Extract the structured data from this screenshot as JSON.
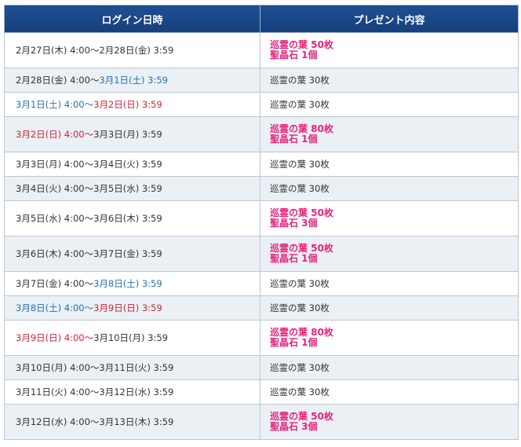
{
  "colors": {
    "header_bg": "#1d4b8e",
    "row_alt": "#eaf0f4",
    "saturday": "#2472b8",
    "sunday": "#d3233a",
    "highlight": "#e5257c"
  },
  "headers": {
    "date": "ログイン日時",
    "present": "プレゼント内容"
  },
  "rows": [
    {
      "alt": false,
      "big": true,
      "date": [
        {
          "t": "2月27日(木) 4:00～2月28日(金) 3:59",
          "c": ""
        }
      ],
      "present": [
        "巡霊の葉 50枚",
        "聖晶石 1個"
      ],
      "hl": true
    },
    {
      "alt": true,
      "big": false,
      "date": [
        {
          "t": "2月28日(金) 4:00～",
          "c": ""
        },
        {
          "t": "3月1日(土) 3:59",
          "c": "sat"
        }
      ],
      "present": [
        "巡霊の葉 30枚"
      ],
      "hl": false
    },
    {
      "alt": false,
      "big": false,
      "date": [
        {
          "t": "3月1日(土) 4:00～",
          "c": "sat"
        },
        {
          "t": "3月2日(日) 3:59",
          "c": "sun"
        }
      ],
      "present": [
        "巡霊の葉 30枚"
      ],
      "hl": false
    },
    {
      "alt": true,
      "big": true,
      "date": [
        {
          "t": "3月2日(日) 4:00～",
          "c": "sun"
        },
        {
          "t": "3月3日(月) 3:59",
          "c": ""
        }
      ],
      "present": [
        "巡霊の葉 80枚",
        "聖晶石 1個"
      ],
      "hl": true
    },
    {
      "alt": false,
      "big": false,
      "date": [
        {
          "t": "3月3日(月) 4:00～3月4日(火) 3:59",
          "c": ""
        }
      ],
      "present": [
        "巡霊の葉 30枚"
      ],
      "hl": false
    },
    {
      "alt": true,
      "big": false,
      "date": [
        {
          "t": "3月4日(火) 4:00～3月5日(水) 3:59",
          "c": ""
        }
      ],
      "present": [
        "巡霊の葉 30枚"
      ],
      "hl": false
    },
    {
      "alt": false,
      "big": true,
      "date": [
        {
          "t": "3月5日(水) 4:00～3月6日(木) 3:59",
          "c": ""
        }
      ],
      "present": [
        "巡霊の葉 50枚",
        "聖晶石 3個"
      ],
      "hl": true
    },
    {
      "alt": true,
      "big": true,
      "date": [
        {
          "t": "3月6日(木) 4:00～3月7日(金) 3:59",
          "c": ""
        }
      ],
      "present": [
        "巡霊の葉 50枚",
        "聖晶石 1個"
      ],
      "hl": true
    },
    {
      "alt": false,
      "big": false,
      "date": [
        {
          "t": "3月7日(金) 4:00～",
          "c": ""
        },
        {
          "t": "3月8日(土) 3:59",
          "c": "sat"
        }
      ],
      "present": [
        "巡霊の葉 30枚"
      ],
      "hl": false
    },
    {
      "alt": true,
      "big": false,
      "date": [
        {
          "t": "3月8日(土) 4:00～",
          "c": "sat"
        },
        {
          "t": "3月9日(日) 3:59",
          "c": "sun"
        }
      ],
      "present": [
        "巡霊の葉 30枚"
      ],
      "hl": false
    },
    {
      "alt": false,
      "big": true,
      "date": [
        {
          "t": "3月9日(日) 4:00～",
          "c": "sun"
        },
        {
          "t": "3月10日(月) 3:59",
          "c": ""
        }
      ],
      "present": [
        "巡霊の葉 80枚",
        "聖晶石 1個"
      ],
      "hl": true
    },
    {
      "alt": true,
      "big": false,
      "date": [
        {
          "t": "3月10日(月) 4:00～3月11日(火) 3:59",
          "c": ""
        }
      ],
      "present": [
        "巡霊の葉 30枚"
      ],
      "hl": false
    },
    {
      "alt": false,
      "big": false,
      "date": [
        {
          "t": "3月11日(火) 4:00～3月12日(水) 3:59",
          "c": ""
        }
      ],
      "present": [
        "巡霊の葉 30枚"
      ],
      "hl": false
    },
    {
      "alt": true,
      "big": true,
      "date": [
        {
          "t": "3月12日(水) 4:00～3月13日(木) 3:59",
          "c": ""
        }
      ],
      "present": [
        "巡霊の葉 50枚",
        "聖晶石 3個"
      ],
      "hl": true
    }
  ]
}
